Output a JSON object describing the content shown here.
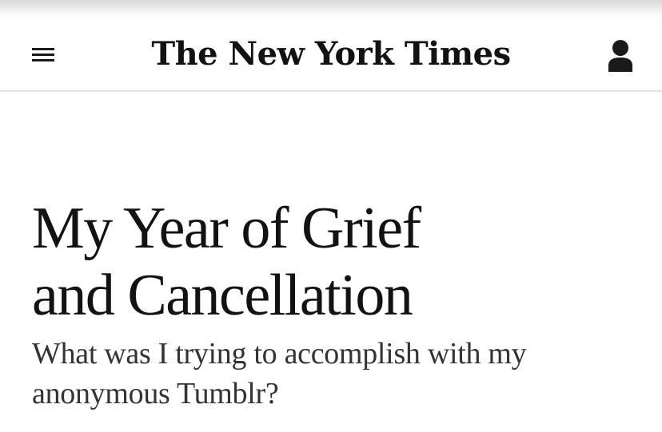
{
  "header": {
    "logo_text": "The New York Times",
    "menu_icon": "hamburger-menu-icon",
    "account_icon": "user-account-icon"
  },
  "article": {
    "headline_line1": "My Year of Grief",
    "headline_line2": "and Cancellation",
    "subheadline_line1": "What was I trying to accomplish with my",
    "subheadline_line2": "anonymous Tumblr?"
  },
  "colors": {
    "text": "#121212",
    "subtext": "#333333",
    "divider": "#e2e2e2",
    "background": "#ffffff"
  }
}
